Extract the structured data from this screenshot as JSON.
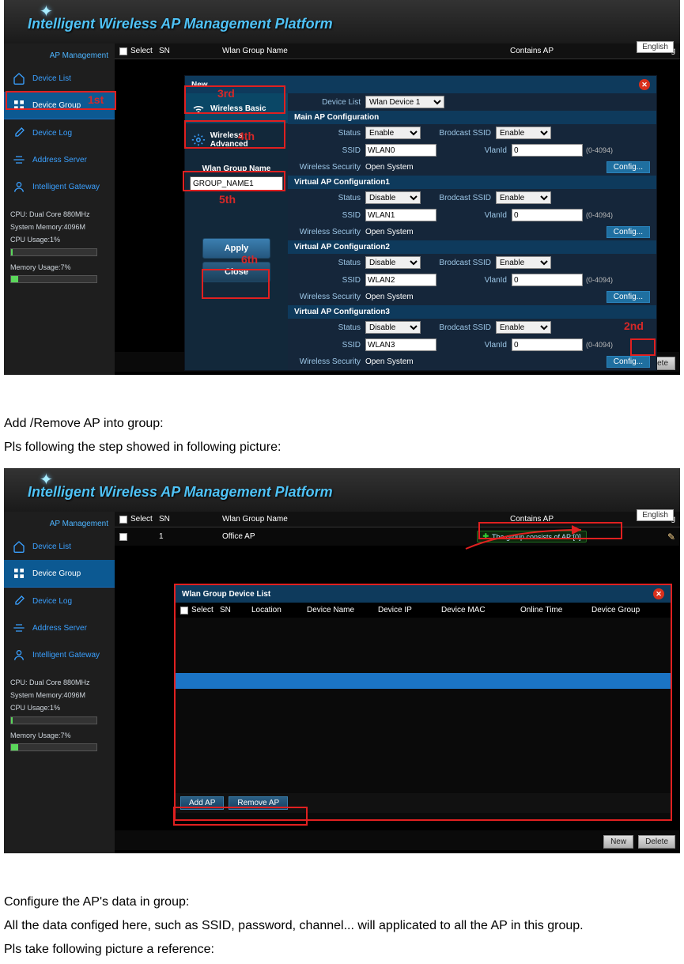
{
  "platform_title": "Intelligent Wireless AP Management Platform",
  "english_label": "English",
  "sidebar": {
    "header": "AP Management",
    "items": [
      {
        "label": "Device List"
      },
      {
        "label": "Device Group"
      },
      {
        "label": "Device Log"
      },
      {
        "label": "Address Server"
      },
      {
        "label": "Intelligent Gateway"
      }
    ]
  },
  "sysinfo": {
    "cpu": "CPU: Dual Core 880MHz",
    "mem_total": "System Memory:4096M",
    "cpu_usage": "CPU Usage:1%",
    "mem_usage": "Memory Usage:7%"
  },
  "columns": {
    "select": "Select",
    "sn": "SN",
    "group": "Wlan Group Name",
    "contain": "Contains AP",
    "config": "Config"
  },
  "footer": {
    "new": "New",
    "delete": "Delete"
  },
  "dialog1": {
    "title": "New",
    "left_basic": "Wireless Basic",
    "left_adv": "Wireless Advanced",
    "group_name_label": "Wlan Group Name",
    "group_name_value": "GROUP_NAME1",
    "apply": "Apply",
    "close": "Close",
    "device_list_label": "Device List",
    "device_list_value": "Wlan Device 1",
    "sections": [
      "Main AP Configuration",
      "Virtual AP Configuration1",
      "Virtual AP Configuration2",
      "Virtual AP Configuration3"
    ],
    "labels": {
      "status": "Status",
      "broadcast": "Brodcast SSID",
      "ssid": "SSID",
      "vlanid": "VlanId",
      "security": "Wireless Security",
      "open_system": "Open System",
      "config": "Config...",
      "hint": "(0-4094)",
      "enable": "Enable",
      "disable": "Disable"
    },
    "rows": [
      {
        "status": "Enable",
        "ssid": "WLAN0",
        "vlan": "0",
        "bcast": "Enable"
      },
      {
        "status": "Disable",
        "ssid": "WLAN1",
        "vlan": "0",
        "bcast": "Enable"
      },
      {
        "status": "Disable",
        "ssid": "WLAN2",
        "vlan": "0",
        "bcast": "Enable"
      },
      {
        "status": "Disable",
        "ssid": "WLAN3",
        "vlan": "0",
        "bcast": "Enable"
      }
    ]
  },
  "annotations": {
    "first": "1st",
    "second": "2nd",
    "third": "3rd",
    "fourth": "4th",
    "fifth": "5th",
    "sixth": "6th"
  },
  "between1_a": "Add /Remove AP into group:",
  "between1_b": "Pls following the step showed in following picture:",
  "row2": {
    "sn": "1",
    "group": "Office AP",
    "contain": "The group consists of AP:[0]"
  },
  "dialog2": {
    "title": "Wlan Group Device List",
    "cols": {
      "select": "Select",
      "sn": "SN",
      "loc": "Location",
      "name": "Device Name",
      "ip": "Device IP",
      "mac": "Device MAC",
      "time": "Online Time",
      "grp": "Device Group"
    },
    "add": "Add AP",
    "remove": "Remove AP"
  },
  "after2_a": "Configure the AP's data in group:",
  "after2_b": "All the data configed here, such as SSID, password, channel... will applicated to all the AP in this group.",
  "after2_c": "Pls take following picture a reference:"
}
